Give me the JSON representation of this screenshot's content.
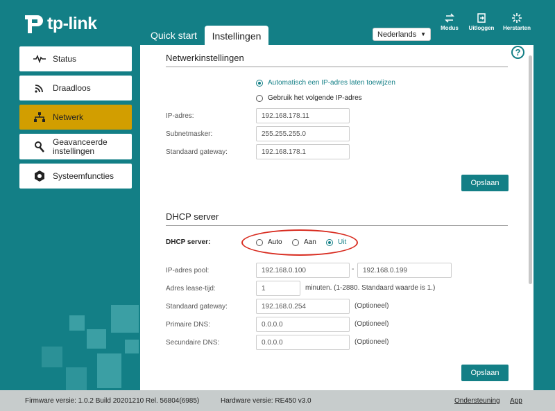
{
  "brand": {
    "logo_text": "tp-link"
  },
  "tabs": [
    {
      "label": "Quick start"
    },
    {
      "label": "Instellingen"
    }
  ],
  "language": {
    "selected": "Nederlands"
  },
  "top_actions": [
    {
      "label": "Modus"
    },
    {
      "label": "Uitloggen"
    },
    {
      "label": "Herstarten"
    }
  ],
  "sidebar": {
    "items": [
      {
        "label": "Status",
        "icon": "pulse-icon"
      },
      {
        "label": "Draadloos",
        "icon": "wireless-icon"
      },
      {
        "label": "Netwerk",
        "icon": "network-icon",
        "active": true
      },
      {
        "label": "Geavanceerde instellingen",
        "icon": "wrench-icon"
      },
      {
        "label": "Systeemfuncties",
        "icon": "gear-icon"
      }
    ]
  },
  "network": {
    "title": "Netwerkinstellingen",
    "option_auto": "Automatisch een IP-adres laten toewijzen",
    "option_manual": "Gebruik het volgende IP-adres",
    "ip_label": "IP-adres:",
    "ip_value": "192.168.178.11",
    "subnet_label": "Subnetmasker:",
    "subnet_value": "255.255.255.0",
    "gateway_label": "Standaard gateway:",
    "gateway_value": "192.168.178.1",
    "save": "Opslaan"
  },
  "dhcp": {
    "title": "DHCP server",
    "server_label": "DHCP server:",
    "opt_auto": "Auto",
    "opt_on": "Aan",
    "opt_off": "Uit",
    "pool_label": "IP-adres pool:",
    "pool_start": "192.168.0.100",
    "pool_sep": "-",
    "pool_end": "192.168.0.199",
    "lease_label": "Adres lease-tijd:",
    "lease_value": "1",
    "lease_note": "minuten. (1-2880. Standaard waarde is 1.)",
    "gateway_label": "Standaard gateway:",
    "gateway_value": "192.168.0.254",
    "primary_dns_label": "Primaire DNS:",
    "primary_dns_value": "0.0.0.0",
    "secondary_dns_label": "Secundaire DNS:",
    "secondary_dns_value": "0.0.0.0",
    "optional": "(Optioneel)",
    "save": "Opslaan"
  },
  "footer": {
    "firmware": "Firmware versie: 1.0.2 Build 20201210 Rel. 56804(6985)",
    "hardware": "Hardware versie: RE450 v3.0",
    "support": "Ondersteuning",
    "app": "App"
  },
  "colors": {
    "teal": "#137f86",
    "active": "#d29e00",
    "highlight": "#d82c20"
  }
}
